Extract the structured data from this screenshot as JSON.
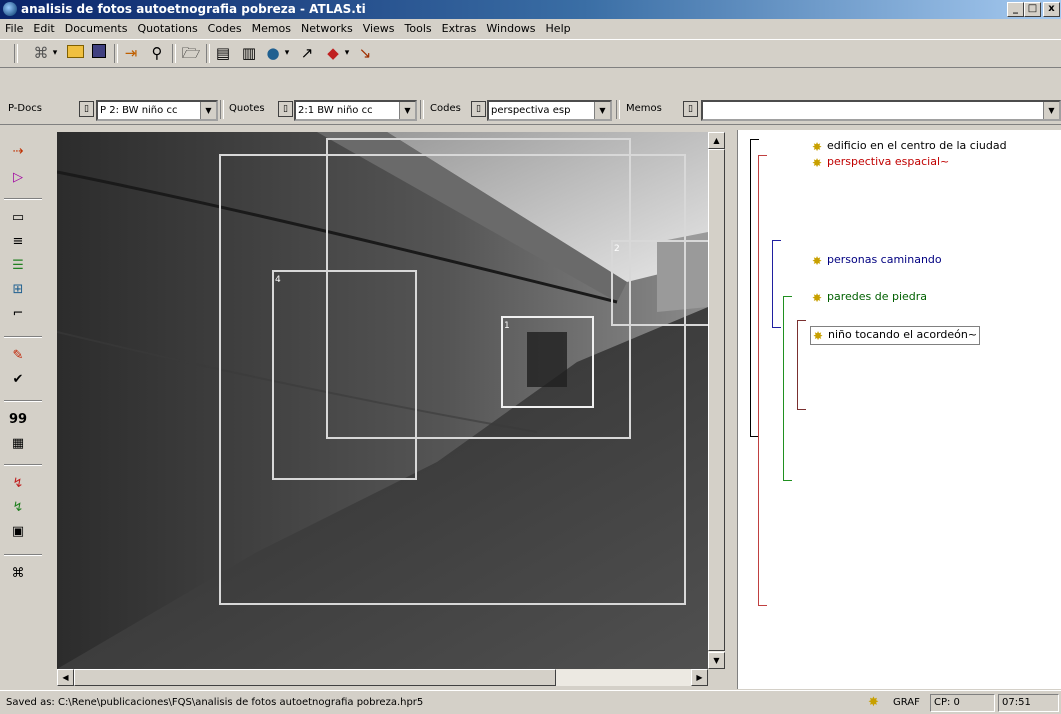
{
  "window": {
    "title": "analisis de fotos autoetnografia pobreza - ATLAS.ti",
    "controls": [
      "_",
      "□",
      "x"
    ]
  },
  "menu": [
    "File",
    "Edit",
    "Documents",
    "Quotations",
    "Codes",
    "Memos",
    "Networks",
    "Views",
    "Tools",
    "Extras",
    "Windows",
    "Help"
  ],
  "toolbar2": {
    "pdocs_label": "P-Docs",
    "pdocs_value": "P 2: BW niño cc",
    "quotes_label": "Quotes",
    "quotes_value": "2:1 BW niño cc",
    "codes_label": "Codes",
    "codes_value": "perspectiva esp",
    "memos_label": "Memos",
    "memos_value": ""
  },
  "left_toolbar": {
    "quotes_count": "99"
  },
  "image_pane": {
    "quotation_numbers": [
      "1",
      "2",
      "4"
    ]
  },
  "margin_codes": [
    {
      "label": "edificio en el centro de la ciudad",
      "color": "#000000"
    },
    {
      "label": "perspectiva espacial~",
      "color": "#c00000"
    },
    {
      "label": "personas caminando",
      "color": "#000080"
    },
    {
      "label": "paredes de piedra",
      "color": "#006000"
    },
    {
      "label": "niño tocando el acordeón~",
      "color": "#000000"
    }
  ],
  "status": {
    "saved": "Saved as: C:\\Rene\\publicaciones\\FQS\\analisis de fotos autoetnografia pobreza.hpr5",
    "mode": "GRAF",
    "cp": "CP: 0",
    "time": "07:51"
  },
  "colors": {
    "titlebar": "#0a246a",
    "chrome": "#d4d0c8",
    "bracket_red": "#c04040",
    "bracket_blue": "#2020a0",
    "bracket_green": "#209020",
    "bracket_brown": "#7a3030"
  }
}
